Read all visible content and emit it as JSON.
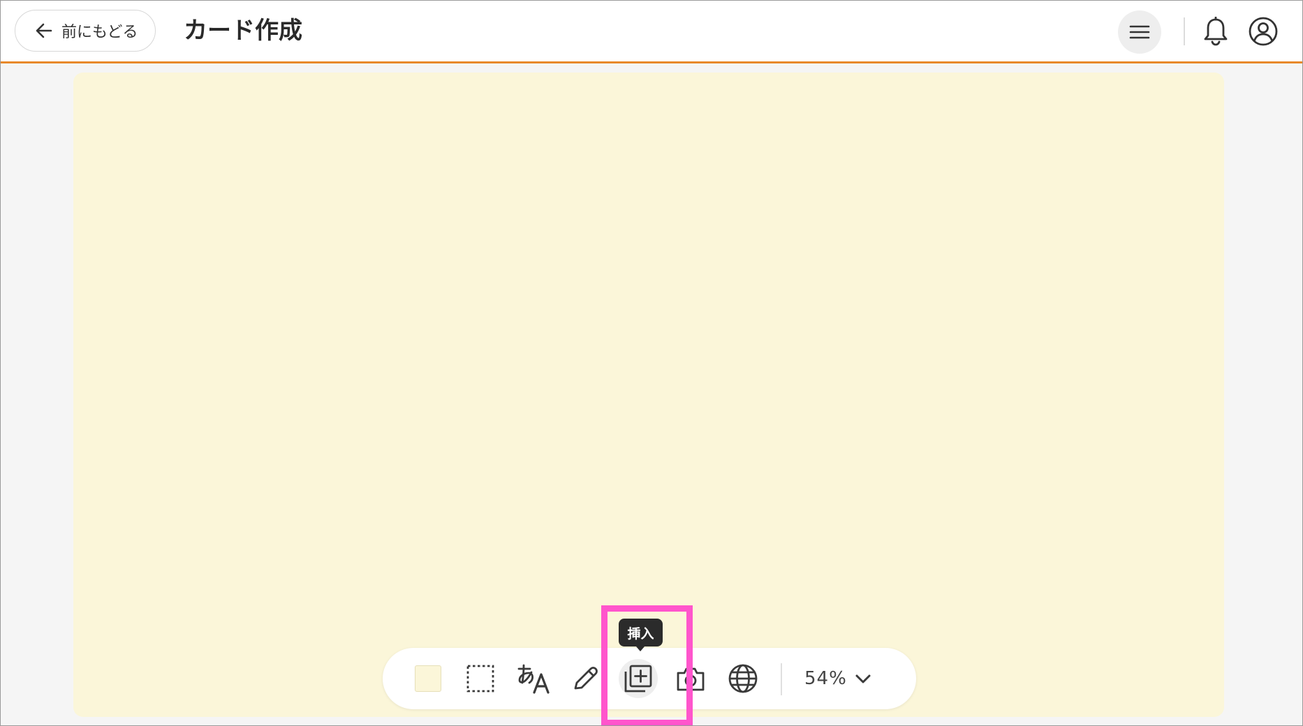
{
  "header": {
    "back_label": "前にもどる",
    "title": "カード作成",
    "icons": {
      "back": "arrow-left-icon",
      "menu": "hamburger-menu-icon",
      "notifications": "bell-icon",
      "account": "account-circle-icon"
    }
  },
  "canvas": {
    "background_color": "#fbf6d9"
  },
  "toolbar": {
    "tools": [
      {
        "name": "background-color",
        "icon": "color-swatch-icon"
      },
      {
        "name": "select",
        "icon": "dashed-selection-icon"
      },
      {
        "name": "text",
        "icon": "text-a-icon"
      },
      {
        "name": "pen",
        "icon": "pencil-icon"
      },
      {
        "name": "insert",
        "icon": "add-to-library-icon",
        "active": true
      },
      {
        "name": "camera",
        "icon": "camera-icon"
      },
      {
        "name": "web",
        "icon": "globe-icon"
      }
    ],
    "zoom": {
      "value": "54%",
      "icon": "chevron-down-icon"
    },
    "tooltip": "挿入"
  },
  "colors": {
    "accent": "#e8892a",
    "highlight": "#ff55cc",
    "tooltip_bg": "#2b2b2b"
  }
}
